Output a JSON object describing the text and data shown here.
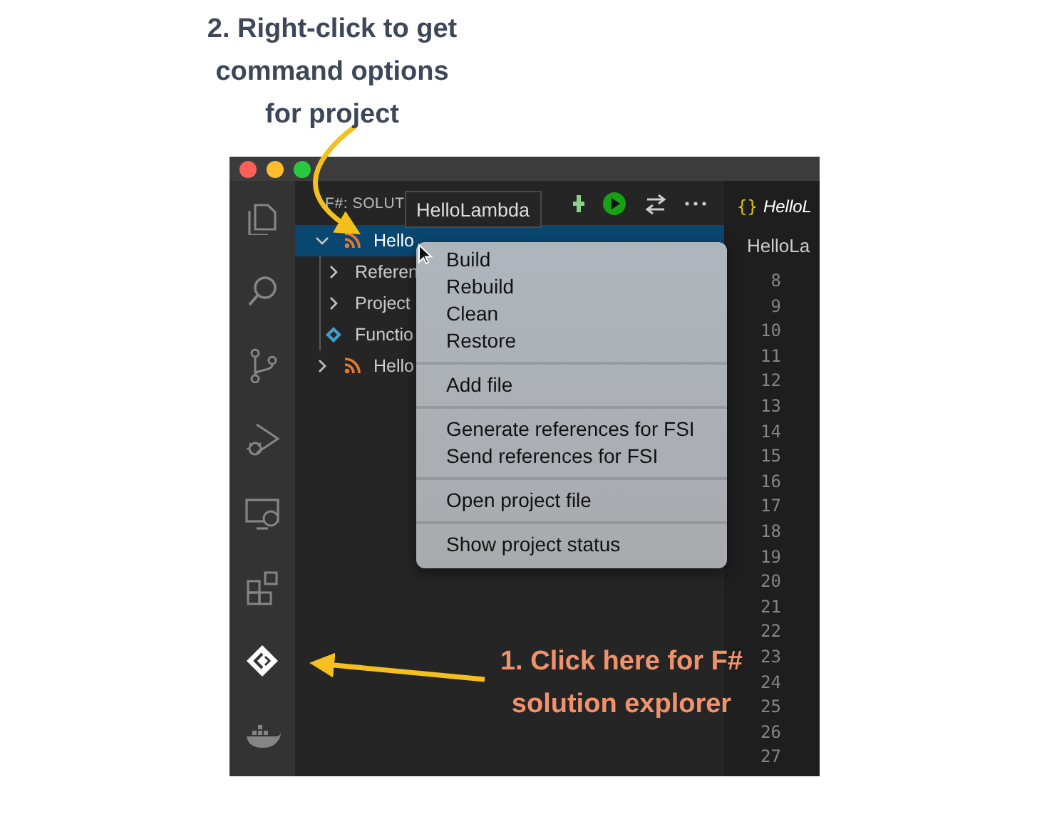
{
  "annotations": [
    {
      "kind": "top",
      "lines": [
        "2. Right-click to get",
        "command options",
        "for project"
      ],
      "color": "#3d4759"
    },
    {
      "kind": "bottom",
      "lines": [
        "1. Click here for F#",
        "solution explorer"
      ],
      "color": "#f0936c"
    }
  ],
  "activity_bar": [
    {
      "selected": false
    },
    {
      "selected": false
    },
    {
      "selected": false
    },
    {
      "selected": false
    },
    {
      "selected": false
    },
    {
      "selected": false
    },
    {
      "selected": true
    },
    {
      "selected": false
    }
  ],
  "sidebar": {
    "title": "F#: SOLUT",
    "tooltip": "HelloLambda",
    "tree": [
      {
        "label": "Hello",
        "kind": "project",
        "expanded": true,
        "selected": true,
        "children": [
          {
            "label": "Referen",
            "kind": "folder",
            "expanded": false,
            "selected": false
          },
          {
            "label": "Project",
            "kind": "folder",
            "expanded": false,
            "selected": false
          },
          {
            "label": "Functio",
            "kind": "file",
            "selected": false
          }
        ]
      },
      {
        "label": "Hello",
        "kind": "project",
        "expanded": false,
        "selected": false
      }
    ]
  },
  "context_menu": [
    {
      "items": [
        "Build",
        "Rebuild",
        "Clean",
        "Restore"
      ]
    },
    {
      "items": [
        "Add file"
      ]
    },
    {
      "items": [
        "Generate references for FSI",
        "Send references for FSI"
      ]
    },
    {
      "items": [
        "Open project file"
      ]
    },
    {
      "items": [
        "Show project status"
      ]
    }
  ],
  "editor": {
    "tab": {
      "icon": "{}",
      "label": "HelloL"
    },
    "breadcrumb": "HelloLa",
    "line_numbers": [
      "8",
      "9",
      "10",
      "11",
      "12",
      "13",
      "14",
      "15",
      "16",
      "17",
      "18",
      "19",
      "20",
      "21",
      "22",
      "23",
      "24",
      "25",
      "26",
      "27"
    ]
  }
}
